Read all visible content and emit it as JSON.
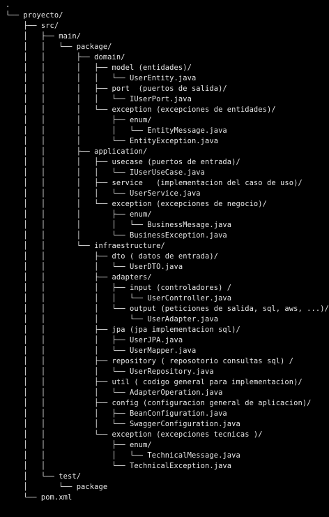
{
  "terminal": {
    "background": "#000000",
    "text_color": "#e6e6e6",
    "lines": [
      ".",
      "└── proyecto/",
      "    ├── src/",
      "    │   ├── main/",
      "    │   │   └── package/",
      "    │   │       ├── domain/",
      "    │   │       │   ├── model (entidades)/",
      "    │   │       │   │   └── UserEntity.java",
      "    │   │       │   ├── port  (puertos de salida)/",
      "    │   │       │   │   └── IUserPort.java",
      "    │   │       │   └── exception (excepciones de entidades)/",
      "    │   │       │       ├── enum/",
      "    │   │       │       │   └── EntityMessage.java",
      "    │   │       │       └── EntityException.java",
      "    │   │       ├── application/",
      "    │   │       │   ├── usecase (puertos de entrada)/",
      "    │   │       │   │   └── IUserUseCase.java",
      "    │   │       │   ├── service   (implementacion del caso de uso)/",
      "    │   │       │   │   └── UserService.java",
      "    │   │       │   └── exception (excepciones de negocio)/",
      "    │   │       │       ├── enum/",
      "    │   │       │       │   └── BusinessMesage.java",
      "    │   │       │       └── BusinessException.java",
      "    │   │       └── infraestructure/",
      "    │   │           ├── dto ( datos de entrada)/",
      "    │   │           │   └── UserDTO.java",
      "    │   │           ├── adapters/",
      "    │   │           │   ├── input (controladores) /",
      "    │   │           │   │   └── UserController.java",
      "    │   │           │   └── output (peticiones de salida, sql, aws, ...)/",
      "    │   │           │       └── UserAdapter.java",
      "    │   │           ├── jpa (jpa implementacion sql)/",
      "    │   │           │   ├── UserJPA.java",
      "    │   │           │   └── UserMapper.java",
      "    │   │           ├── repository ( reposotorio consultas sql) /",
      "    │   │           │   └── UserRepository.java",
      "    │   │           ├── util ( codigo general para implementacion)/",
      "    │   │           │   └── AdapterOperation.java",
      "    │   │           ├── config (configuracion general de aplicacion)/",
      "    │   │           │   ├── BeanConfiguration.java",
      "    │   │           │   └── SwaggerConfiguration.java",
      "    │   │           └── exception (excepciones tecnicas )/",
      "    │   │               ├── enum/",
      "    │   │               │   └── TechnicalMessage.java",
      "    │   │               └── TechnicalException.java",
      "    │   └── test/",
      "    │       └── package",
      "    └── pom.xml"
    ]
  }
}
